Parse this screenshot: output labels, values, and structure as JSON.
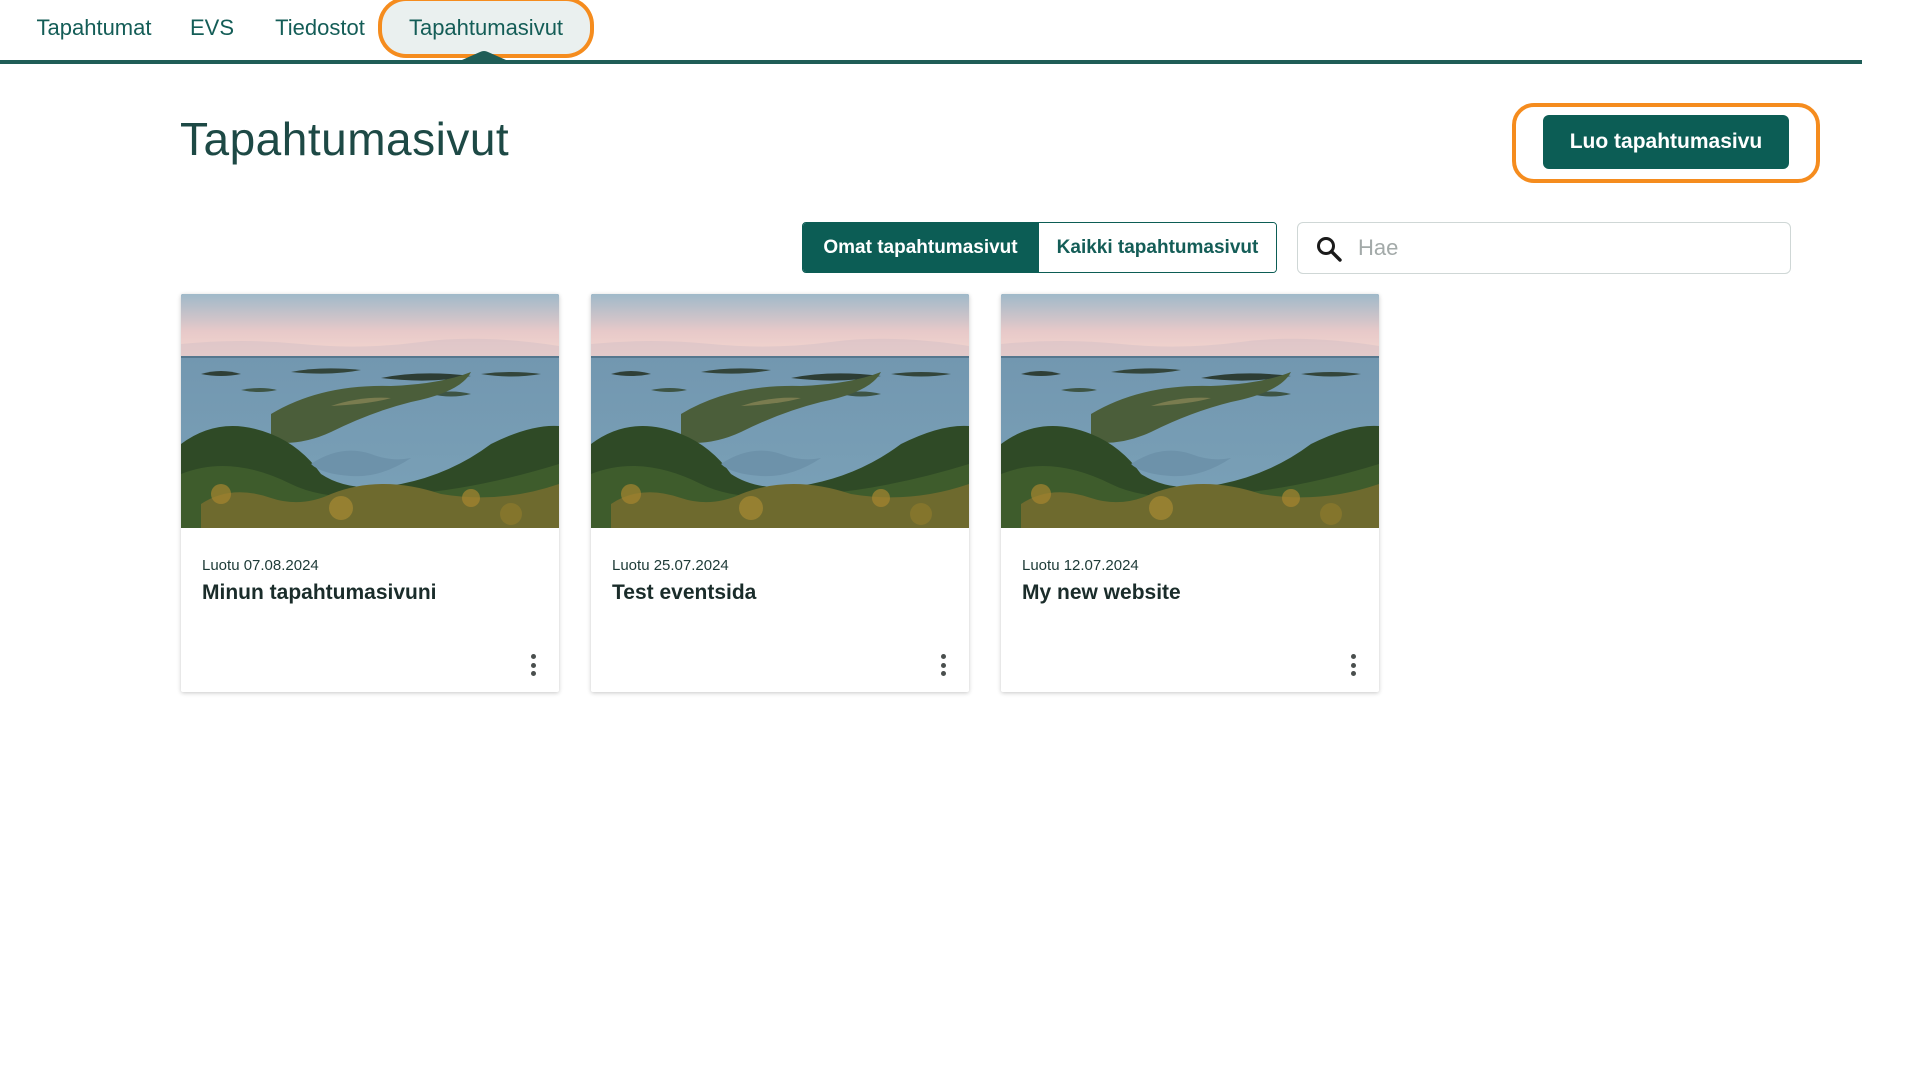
{
  "nav": {
    "tabs": [
      {
        "label": "Tapahtumat"
      },
      {
        "label": "EVS"
      },
      {
        "label": "Tiedostot"
      },
      {
        "label": "Tapahtumasivut",
        "active": true
      }
    ]
  },
  "header": {
    "title": "Tapahtumasivut",
    "create_label": "Luo tapahtumasivu"
  },
  "filter": {
    "own_label": "Omat tapahtumasivut",
    "all_label": "Kaikki tapahtumasivut",
    "selected": "own"
  },
  "search": {
    "placeholder": "Hae",
    "value": ""
  },
  "cards": [
    {
      "date": "Luotu 07.08.2024",
      "title": "Minun tapahtumasivuni"
    },
    {
      "date": "Luotu 25.07.2024",
      "title": "Test eventsida"
    },
    {
      "date": "Luotu 12.07.2024",
      "title": "My new website"
    }
  ],
  "colors": {
    "brand": "#0c5d55",
    "highlight": "#f58c1e",
    "text": "#1d3a37"
  },
  "icons": [
    "search-icon",
    "more-vertical-icon"
  ]
}
